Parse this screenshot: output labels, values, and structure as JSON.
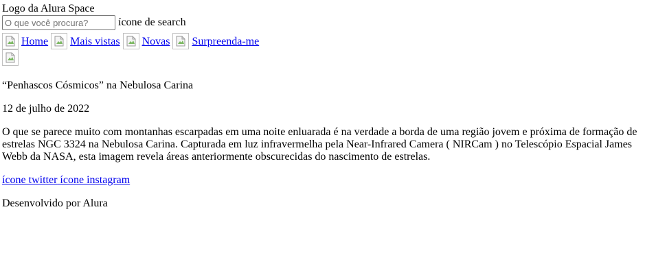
{
  "header": {
    "logo_alt": "Logo da Alura Space",
    "search": {
      "placeholder": "O que você procura?",
      "value": "",
      "icon_alt": "ícone de search"
    }
  },
  "nav": {
    "items": [
      {
        "label": "Home"
      },
      {
        "label": "Mais vistas"
      },
      {
        "label": "Novas"
      },
      {
        "label": "Surpreenda-me"
      }
    ]
  },
  "article": {
    "title": "“Penhascos Cósmicos” na Nebulosa Carina",
    "date": "12 de julho de 2022",
    "description": "O que se parece muito com montanhas escarpadas em uma noite enluarada é na verdade a borda de uma região jovem e próxima de formação de estrelas NGC 3324 na Nebulosa Carina. Capturada em luz infravermelha pela Near-Infrared Camera ( NIRCam ) no Telescópio Espacial James Webb da NASA, esta imagem revela áreas anteriormente obscurecidas do nascimento de estrelas."
  },
  "social": {
    "twitter_alt": "ícone twitter",
    "instagram_alt": "ícone instagram"
  },
  "footer": {
    "text": "Desenvolvido por Alura"
  },
  "colors": {
    "link": "#0000ee",
    "text": "#000000",
    "background": "#ffffff"
  }
}
